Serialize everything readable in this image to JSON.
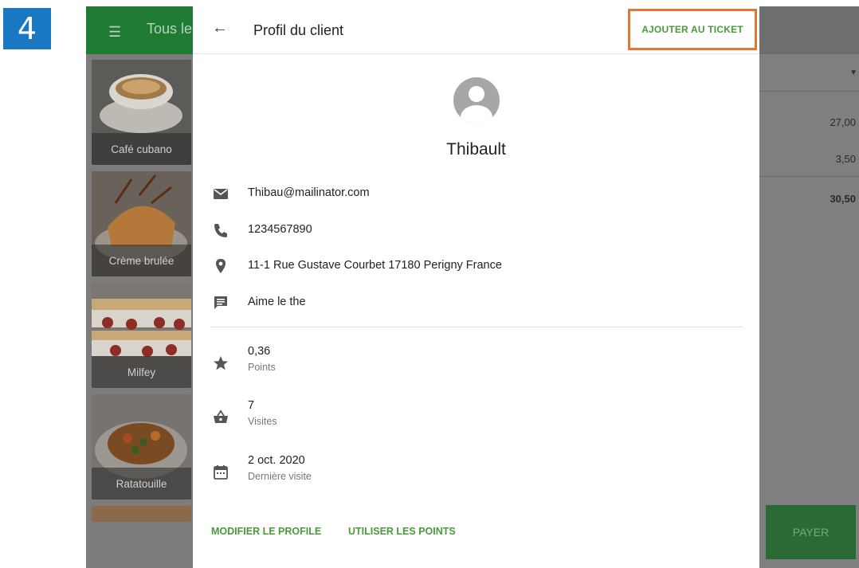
{
  "step_number": "4",
  "background_app": {
    "title": "Tous le",
    "menu_icon": "menu-icon",
    "tiles": [
      {
        "label": "Café cubano",
        "color": "#5a4630"
      },
      {
        "label": "Crème brulée",
        "color": "#a0683a"
      },
      {
        "label": "Milfey",
        "color": "#8a4a3a"
      },
      {
        "label": "Ratatouille",
        "color": "#6a5030"
      }
    ],
    "ticket_amounts": [
      "27,00",
      "3,50",
      "30,50"
    ],
    "pay_label": "PAYER"
  },
  "dialog": {
    "title": "Profil du client",
    "add_to_ticket_label": "AJOUTER AU TICKET",
    "client_name": "Thibault",
    "info": [
      {
        "icon": "email-icon",
        "text": "Thibau@mailinator.com"
      },
      {
        "icon": "phone-icon",
        "text": "1234567890"
      },
      {
        "icon": "location-icon",
        "text": "11-1 Rue Gustave Courbet 17180 Perigny France"
      },
      {
        "icon": "comment-icon",
        "text": "Aime le the"
      }
    ],
    "stats": [
      {
        "icon": "star-icon",
        "value": "0,36",
        "label": "Points"
      },
      {
        "icon": "basket-icon",
        "value": "7",
        "label": "Visites"
      },
      {
        "icon": "calendar-icon",
        "value": "2 oct. 2020",
        "label": "Dernière visite"
      }
    ],
    "edit_profile_label": "MODIFIER LE PROFILE",
    "use_points_label": "UTILISER LES POINTS"
  },
  "colors": {
    "accent_green": "#4a9a3c",
    "highlight_orange": "#e07733",
    "step_blue": "#1a78c2"
  }
}
